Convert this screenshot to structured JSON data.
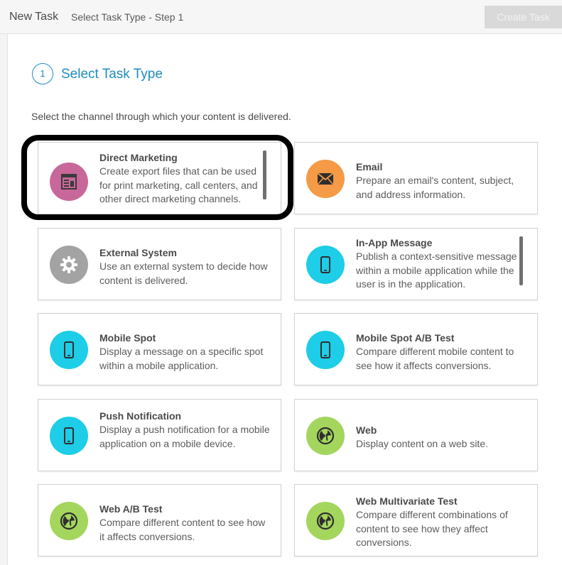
{
  "header": {
    "title": "New Task",
    "subtitle": "Select Task Type - Step 1",
    "create_button": "Create Task"
  },
  "step": {
    "number": "1",
    "title": "Select Task Type"
  },
  "instruction": "Select the channel through which your content is delivered.",
  "cards": [
    {
      "title": "Direct Marketing",
      "description": "Create export files that can be used for print marketing, call centers, and other direct marketing channels.",
      "icon": "direct-marketing-icon",
      "color": "#c8679a"
    },
    {
      "title": "Email",
      "description": "Prepare an email's content, subject, and address information.",
      "icon": "envelope-icon",
      "color": "#f59a46"
    },
    {
      "title": "External System",
      "description": "Use an external system to decide how content is delivered.",
      "icon": "gear-icon",
      "color": "#a3a3a3"
    },
    {
      "title": "In-App Message",
      "description": "Publish a context-sensitive message within a mobile application while the user is in the application.",
      "icon": "mobile-phone-icon",
      "color": "#1ecde7"
    },
    {
      "title": "Mobile Spot",
      "description": "Display a message on a specific spot within a mobile application.",
      "icon": "mobile-phone-icon",
      "color": "#1ecde7"
    },
    {
      "title": "Mobile Spot A/B Test",
      "description": "Compare different mobile content to see how it affects conversions.",
      "icon": "mobile-phone-icon",
      "color": "#1ecde7"
    },
    {
      "title": "Push Notification",
      "description": "Display a push notification for a mobile application on a mobile device.",
      "icon": "mobile-phone-icon",
      "color": "#1ecde7"
    },
    {
      "title": "Web",
      "description": "Display content on a web site.",
      "icon": "globe-icon",
      "color": "#a4d65e"
    },
    {
      "title": "Web A/B Test",
      "description": "Compare different content to see how it affects conversions.",
      "icon": "globe-icon",
      "color": "#a4d65e"
    },
    {
      "title": "Web Multivariate Test",
      "description": "Compare different combinations of content to see how they affect conversions.",
      "icon": "globe-icon",
      "color": "#a4d65e"
    }
  ]
}
